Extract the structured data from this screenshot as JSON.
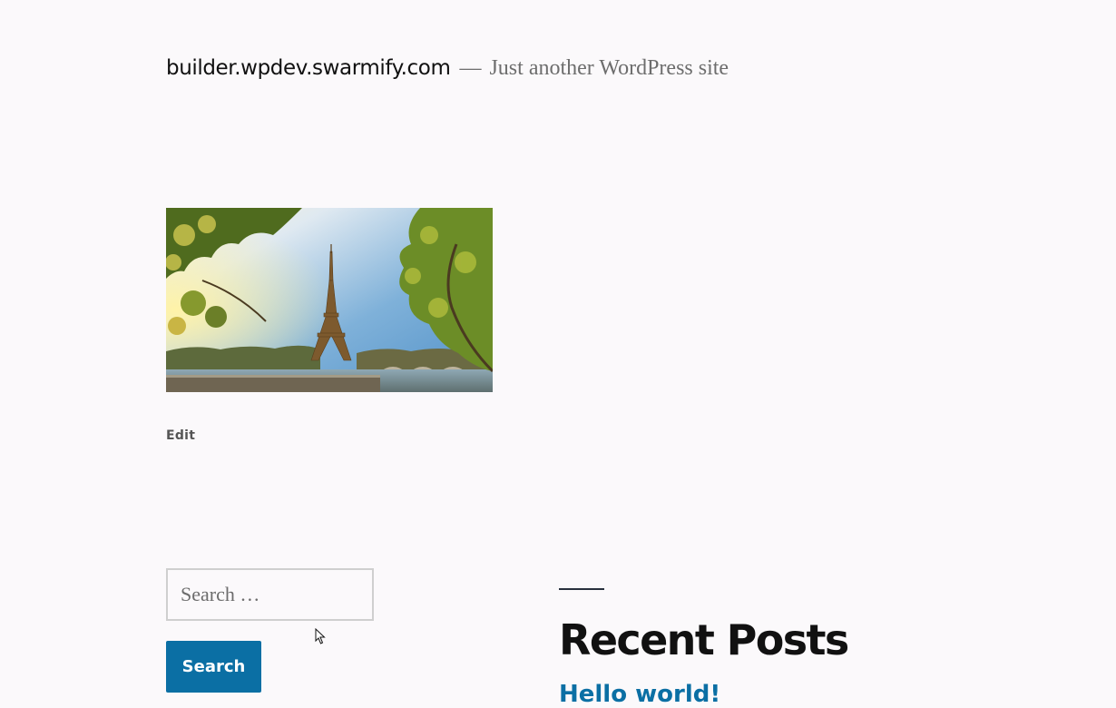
{
  "header": {
    "site_title": "builder.wpdev.swarmify.com",
    "separator": "—",
    "tagline": "Just another WordPress site"
  },
  "post": {
    "image_alt": "Eiffel Tower framed by trees along the Seine",
    "edit_label": "Edit"
  },
  "search": {
    "placeholder": "Search …",
    "value": "",
    "button_label": "Search"
  },
  "recent_posts": {
    "title": "Recent Posts",
    "items": [
      {
        "label": "Hello world!"
      }
    ]
  },
  "colors": {
    "background": "#fbf9fb",
    "accent": "#0b6fa4",
    "text": "#111111"
  }
}
